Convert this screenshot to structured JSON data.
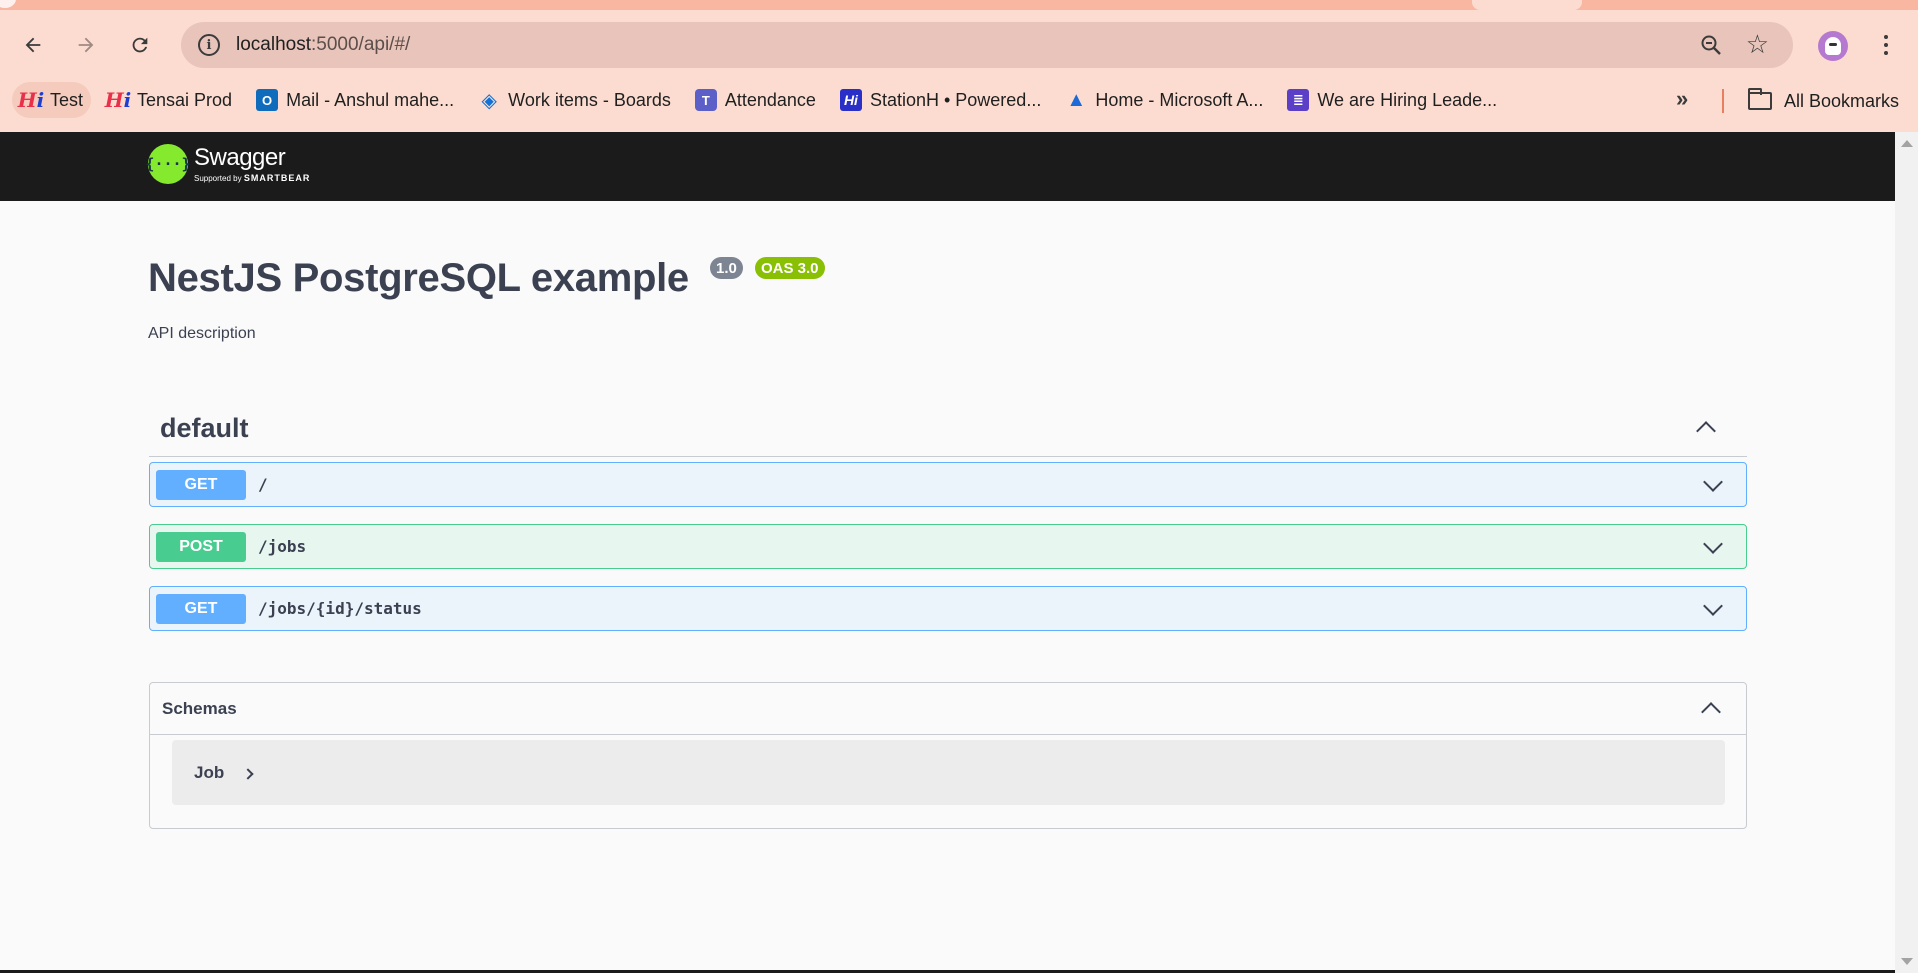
{
  "browser": {
    "url_host": "localhost",
    "url_path": ":5000/api/#/",
    "bookmarks": [
      {
        "label": "Test",
        "icon": "hi-logo-icon"
      },
      {
        "label": "Tensai Prod",
        "icon": "hi-logo-icon"
      },
      {
        "label": "Mail - Anshul mahe...",
        "icon": "outlook-icon"
      },
      {
        "label": "Work items - Boards",
        "icon": "azure-devops-icon"
      },
      {
        "label": "Attendance",
        "icon": "teams-icon"
      },
      {
        "label": "StationH • Powered...",
        "icon": "stationh-icon"
      },
      {
        "label": "Home - Microsoft A...",
        "icon": "azure-icon"
      },
      {
        "label": "We are Hiring Leade...",
        "icon": "forms-icon"
      }
    ],
    "all_bookmarks": "All Bookmarks"
  },
  "swagger": {
    "logo_name": "Swagger",
    "logo_supported": "Supported by",
    "logo_brand": "SMARTBEAR"
  },
  "info": {
    "title": "NestJS PostgreSQL example",
    "version": "1.0",
    "oas": "OAS 3.0",
    "description": "API description"
  },
  "tag": {
    "name": "default",
    "operations": [
      {
        "method": "GET",
        "path": "/"
      },
      {
        "method": "POST",
        "path": "/jobs"
      },
      {
        "method": "GET",
        "path": "/jobs/{id}/status"
      }
    ]
  },
  "schemas": {
    "title": "Schemas",
    "models": [
      "Job"
    ]
  },
  "colors": {
    "get": "#61affe",
    "post": "#49cc90",
    "swagger_green": "#85ea2d",
    "oas_badge": "#89bf04"
  }
}
